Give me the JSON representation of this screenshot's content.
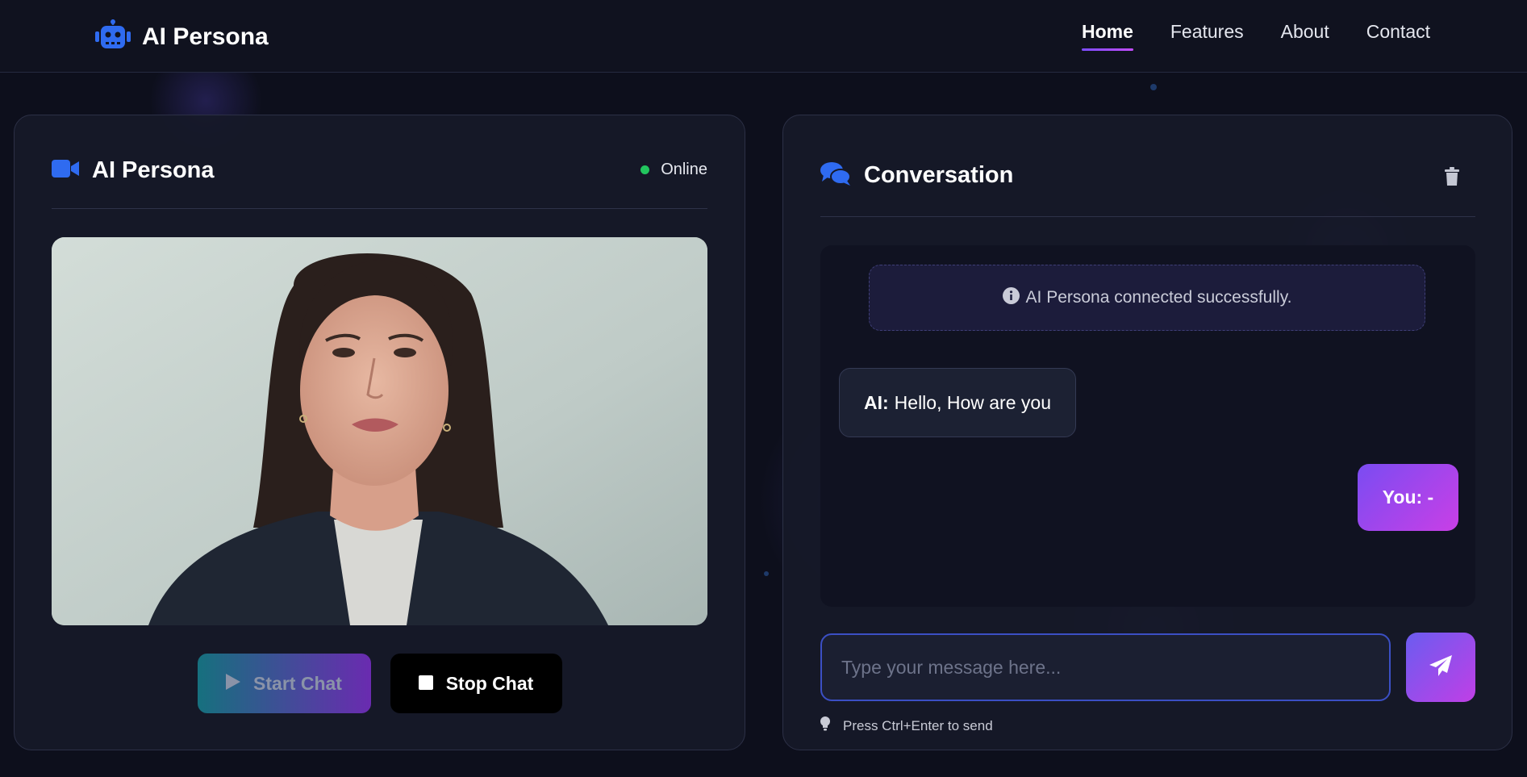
{
  "brand": {
    "title": "AI Persona",
    "icon": "robot-icon"
  },
  "nav": {
    "items": [
      "Home",
      "Features",
      "About",
      "Contact"
    ],
    "active": "Home"
  },
  "persona_panel": {
    "title": "AI Persona",
    "icon": "video-camera-icon",
    "status": "Online",
    "status_color": "#22c55e",
    "start_label": "Start Chat",
    "stop_label": "Stop Chat"
  },
  "conversation": {
    "title": "Conversation",
    "icon": "comments-icon",
    "clear_icon": "trash-icon",
    "system_message": "AI Persona connected successfully.",
    "messages": [
      {
        "role": "ai",
        "speaker": "AI:",
        "text": "Hello, How are you"
      },
      {
        "role": "user",
        "text": "You: -"
      }
    ],
    "input_placeholder": "Type your message here...",
    "input_value": "",
    "send_icon": "paper-plane-icon",
    "hint": "Press Ctrl+Enter to send",
    "hint_icon": "lightbulb-icon"
  },
  "colors": {
    "accent": "#2f6bf0",
    "gradient_start": "#7a4cf2",
    "gradient_end": "#c93fe6",
    "background": "#0d0f1c"
  }
}
